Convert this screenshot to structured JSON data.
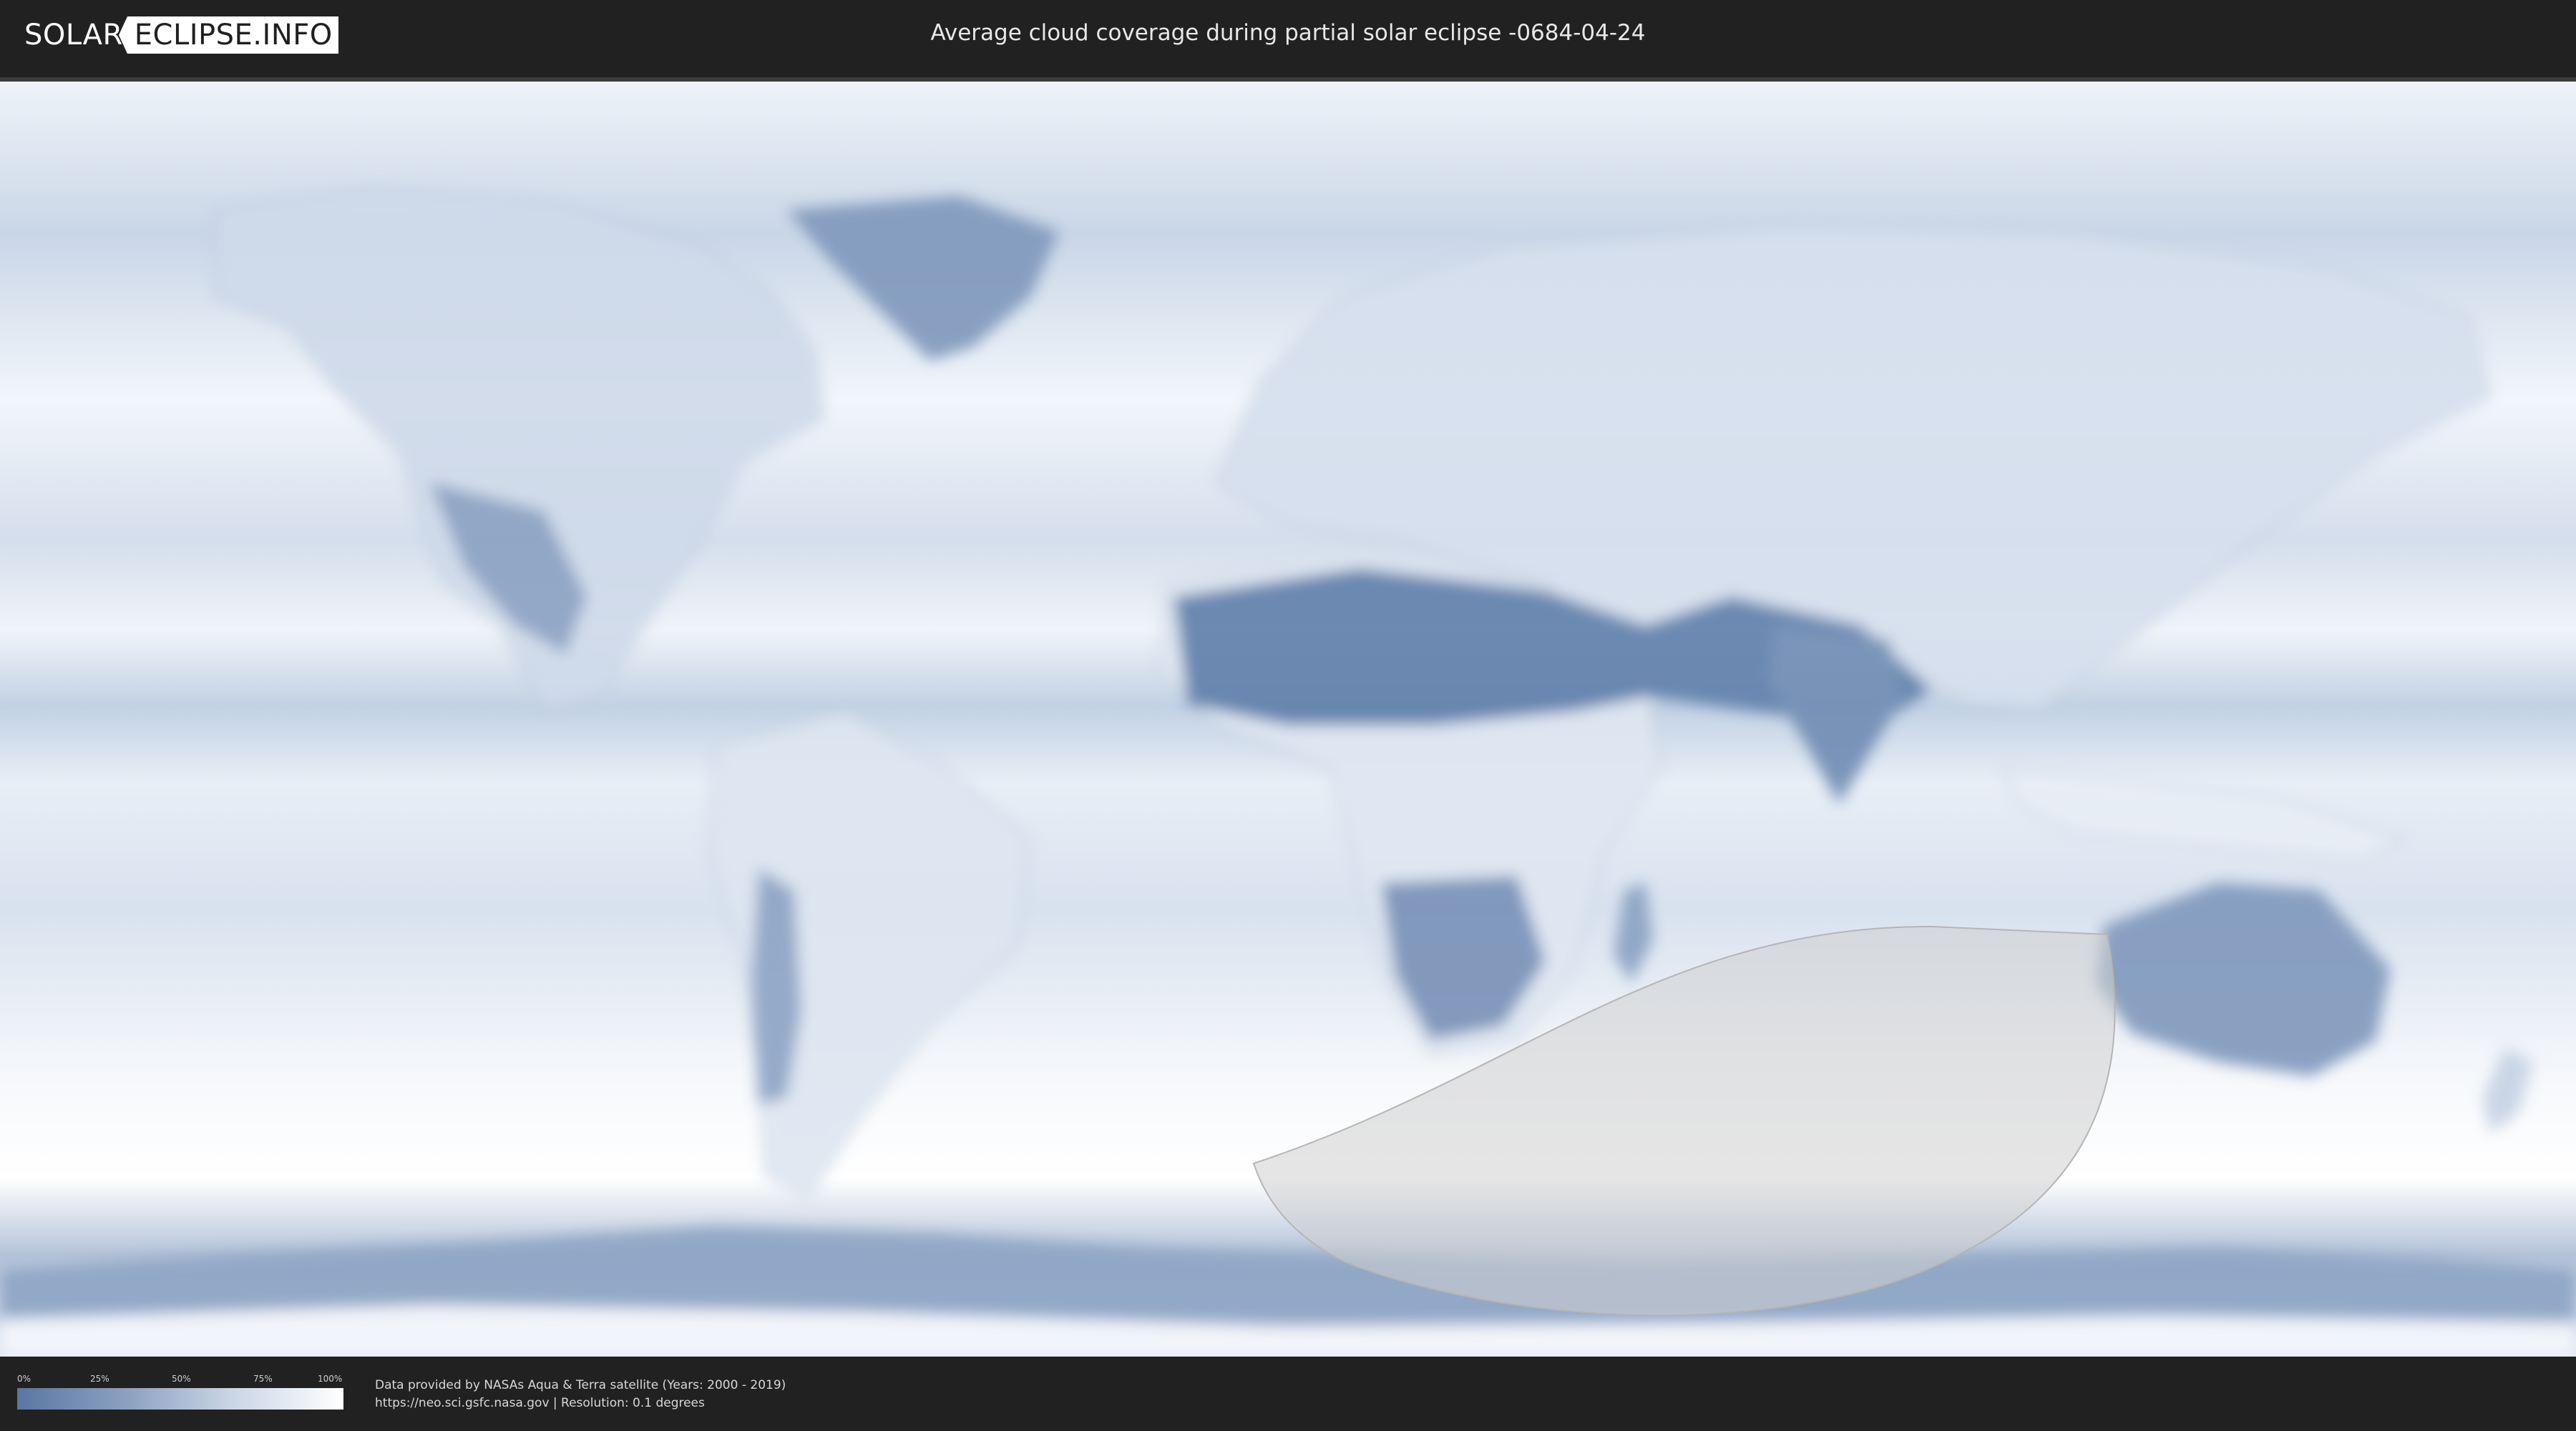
{
  "header": {
    "logo_left": "SOLAR",
    "logo_right": "ECLIPSE.INFO",
    "title": "Average cloud coverage during partial solar eclipse -0684-04-24"
  },
  "legend": {
    "labels": [
      "0%",
      "25%",
      "50%",
      "75%",
      "100%"
    ],
    "colors": {
      "low": "#5a76a2",
      "high": "#ffffff"
    }
  },
  "footer": {
    "credit_line": "Data provided by NASAs Aqua & Terra satellite (Years: 2000 - 2019)",
    "source_line": "https://neo.sci.gsfc.nasa.gov | Resolution: 0.1 degrees"
  },
  "map": {
    "projection": "equirectangular",
    "ocean_color": "#e6eef7",
    "cloud_free_color": "#5f7faa",
    "eclipse_zone_color": "#cfcfcf"
  }
}
